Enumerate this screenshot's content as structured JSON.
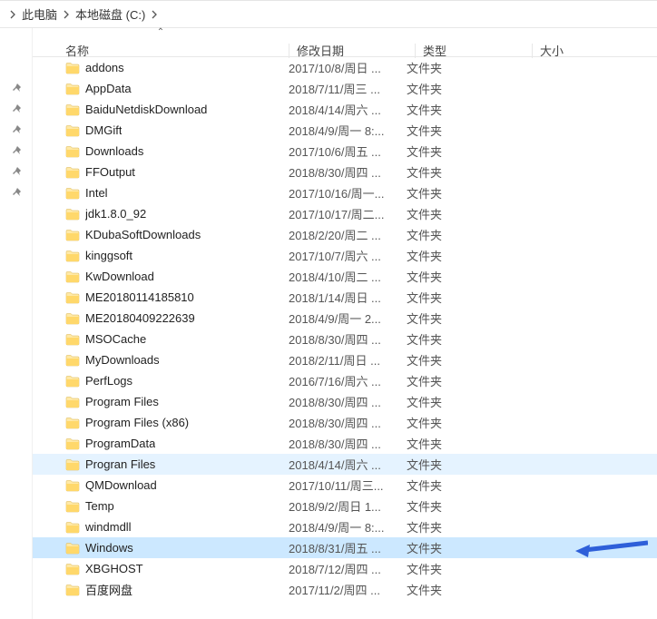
{
  "breadcrumb": {
    "seg1": "此电脑",
    "seg2": "本地磁盘 (C:)"
  },
  "columns": {
    "name": "名称",
    "date": "修改日期",
    "type": "类型",
    "size": "大小"
  },
  "type_label": "文件夹",
  "rows": [
    {
      "name": "addons",
      "date": "2017/10/8/周日 ...",
      "pinned": true,
      "selected": false
    },
    {
      "name": "AppData",
      "date": "2018/7/11/周三 ...",
      "pinned": true,
      "selected": false
    },
    {
      "name": "BaiduNetdiskDownload",
      "date": "2018/4/14/周六 ...",
      "pinned": true,
      "selected": false
    },
    {
      "name": "DMGift",
      "date": "2018/4/9/周一 8:...",
      "pinned": true,
      "selected": false
    },
    {
      "name": "Downloads",
      "date": "2017/10/6/周五 ...",
      "pinned": true,
      "selected": false
    },
    {
      "name": "FFOutput",
      "date": "2018/8/30/周四 ...",
      "pinned": true,
      "selected": false
    },
    {
      "name": "Intel",
      "date": "2017/10/16/周一...",
      "pinned": false,
      "selected": false
    },
    {
      "name": "jdk1.8.0_92",
      "date": "2017/10/17/周二...",
      "pinned": false,
      "selected": false
    },
    {
      "name": "KDubaSoftDownloads",
      "date": "2018/2/20/周二 ...",
      "pinned": false,
      "selected": false
    },
    {
      "name": "kinggsoft",
      "date": "2017/10/7/周六 ...",
      "pinned": false,
      "selected": false
    },
    {
      "name": "KwDownload",
      "date": "2018/4/10/周二 ...",
      "pinned": false,
      "selected": false
    },
    {
      "name": "ME20180114185810",
      "date": "2018/1/14/周日 ...",
      "pinned": false,
      "selected": false
    },
    {
      "name": "ME20180409222639",
      "date": "2018/4/9/周一 2...",
      "pinned": false,
      "selected": false
    },
    {
      "name": "MSOCache",
      "date": "2018/8/30/周四 ...",
      "pinned": false,
      "selected": false
    },
    {
      "name": "MyDownloads",
      "date": "2018/2/11/周日 ...",
      "pinned": false,
      "selected": false
    },
    {
      "name": "PerfLogs",
      "date": "2016/7/16/周六 ...",
      "pinned": false,
      "selected": false
    },
    {
      "name": "Program Files",
      "date": "2018/8/30/周四 ...",
      "pinned": false,
      "selected": false
    },
    {
      "name": "Program Files (x86)",
      "date": "2018/8/30/周四 ...",
      "pinned": false,
      "selected": false
    },
    {
      "name": "ProgramData",
      "date": "2018/8/30/周四 ...",
      "pinned": false,
      "selected": false
    },
    {
      "name": "Progran Files",
      "date": "2018/4/14/周六 ...",
      "pinned": false,
      "selected": false,
      "hover": true
    },
    {
      "name": "QMDownload",
      "date": "2017/10/11/周三...",
      "pinned": false,
      "selected": false
    },
    {
      "name": "Temp",
      "date": "2018/9/2/周日 1...",
      "pinned": false,
      "selected": false
    },
    {
      "name": "windmdll",
      "date": "2018/4/9/周一 8:...",
      "pinned": false,
      "selected": false
    },
    {
      "name": "Windows",
      "date": "2018/8/31/周五 ...",
      "pinned": false,
      "selected": true
    },
    {
      "name": "XBGHOST",
      "date": "2018/7/12/周四 ...",
      "pinned": false,
      "selected": false
    },
    {
      "name": "百度网盘",
      "date": "2017/11/2/周四 ...",
      "pinned": false,
      "selected": false
    }
  ]
}
